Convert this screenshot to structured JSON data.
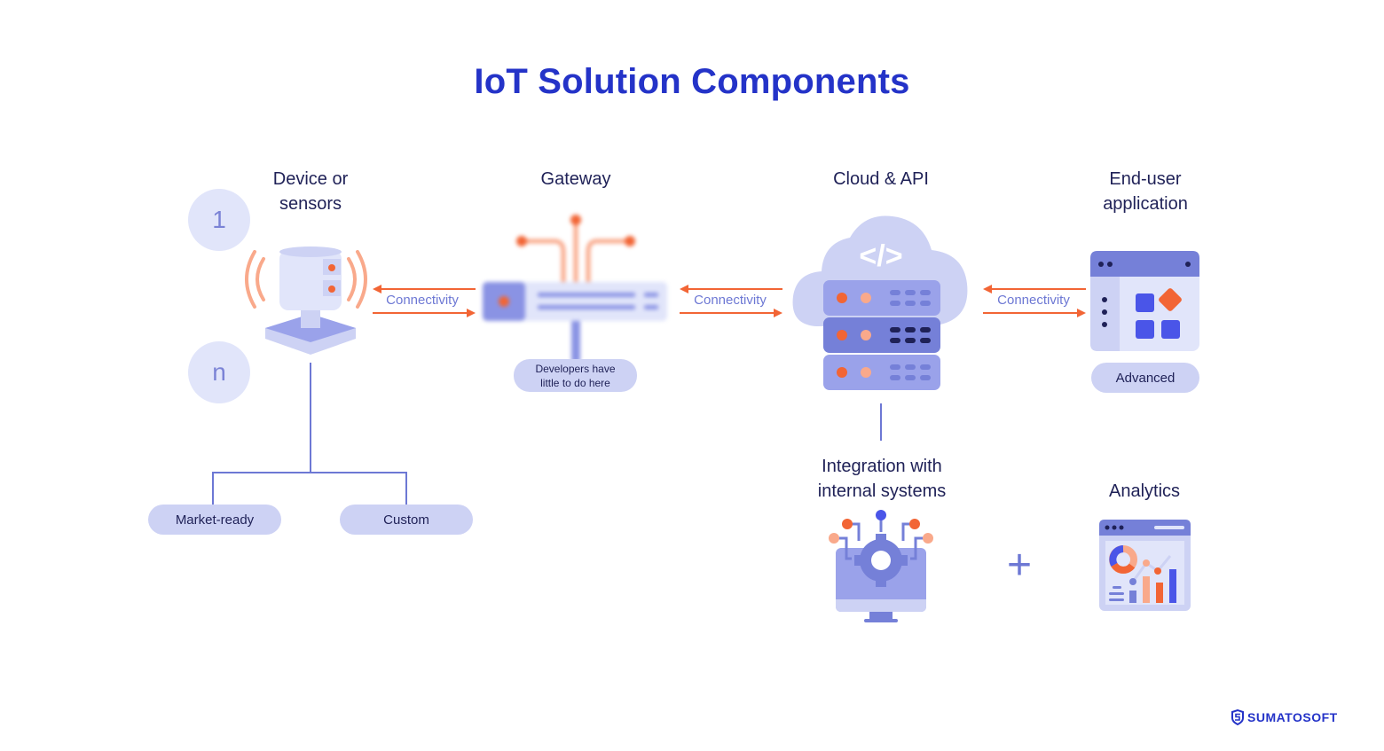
{
  "title": "IoT Solution Components",
  "columns": {
    "device": {
      "label": "Device or\nsensors",
      "line1": "Device or",
      "line2": "sensors",
      "count_start": "1",
      "count_end": "n",
      "options": [
        "Market-ready",
        "Custom"
      ]
    },
    "gateway": {
      "label": "Gateway",
      "note_line1": "Developers have",
      "note_line2": "little to do here"
    },
    "cloud": {
      "label": "Cloud & API",
      "code_symbol": "</>"
    },
    "app": {
      "line1": "End-user",
      "line2": "application",
      "badge": "Advanced"
    }
  },
  "connections": [
    "Connectivity",
    "Connectivity",
    "Connectivity"
  ],
  "extras": {
    "integration_line1": "Integration with",
    "integration_line2": "internal systems",
    "plus_symbol": "+",
    "analytics": "Analytics"
  },
  "colors": {
    "brand": "#2433c8",
    "accent": "#f26535",
    "light_accent": "#f9a98b",
    "primary": "#6d78d4",
    "light": "#cdd2f4",
    "dark_text": "#1f2157"
  },
  "brand": {
    "name": "SUMATOSOFT",
    "icon": "shield-s-icon"
  }
}
